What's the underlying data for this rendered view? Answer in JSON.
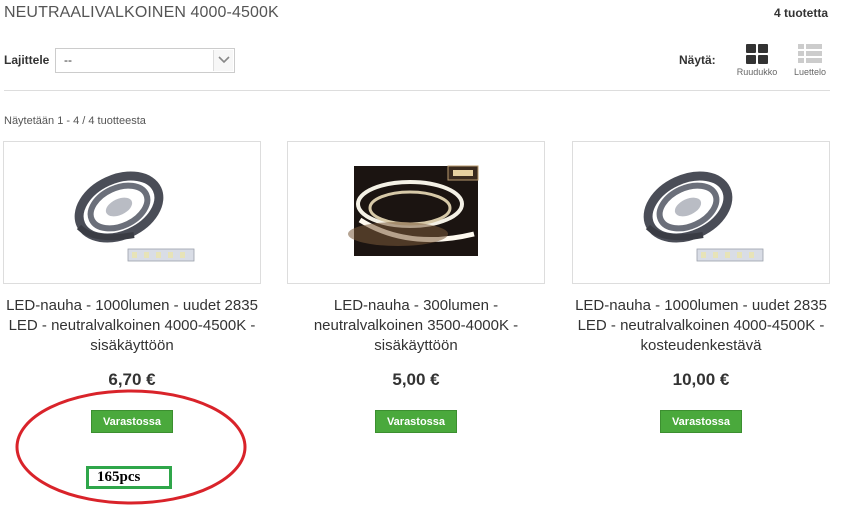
{
  "header": {
    "title": "NEUTRAALIVALKOINEN 4000-4500K",
    "count": "4 tuotetta"
  },
  "toolbar": {
    "sort_label": "Lajittele",
    "sort_value": "--",
    "view_label": "Näytä:",
    "view_grid": "Ruudukko",
    "view_list": "Luettelo"
  },
  "listing": {
    "showing": "Näytetään 1 - 4 / 4 tuotteesta"
  },
  "products": [
    {
      "name": "LED-nauha - 1000lumen - uudet 2835 LED - neutralvalkoinen 4000-4500K - sisäkäyttöön",
      "price": "6,70 €",
      "stock": "Varastossa"
    },
    {
      "name": "LED-nauha - 300lumen - neutralvalkoinen 3500-4000K - sisäkäyttöön",
      "price": "5,00 €",
      "stock": "Varastossa"
    },
    {
      "name": "LED-nauha - 1000lumen - uudet 2835 LED - neutralvalkoinen 4000-4500K - kosteudenkestävä",
      "price": "10,00 €",
      "stock": "Varastossa"
    }
  ],
  "annotation": {
    "quantity": "165pcs",
    "ellipse_color": "#d9232a",
    "box_color": "#2fa64a"
  },
  "colors": {
    "stock_badge": "#4aa93c",
    "view_active": "#333333",
    "view_inactive": "#cccccc"
  }
}
